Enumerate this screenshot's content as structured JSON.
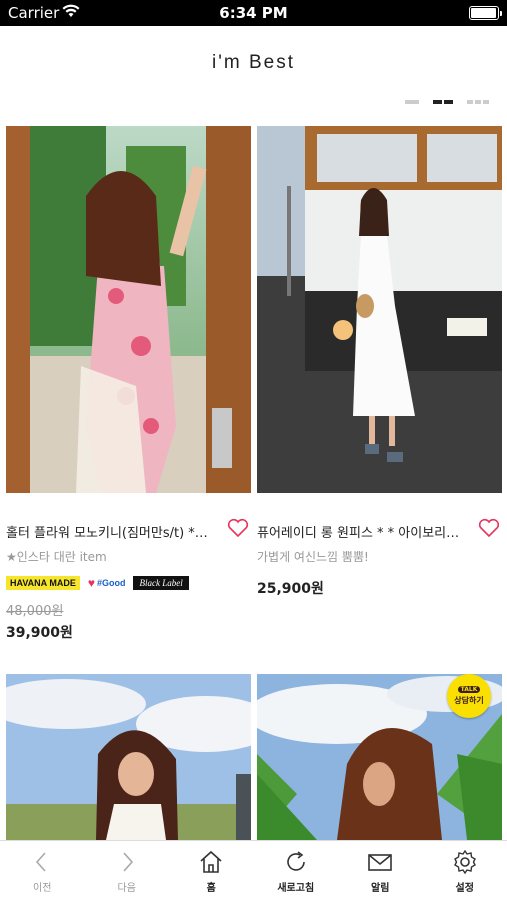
{
  "status_bar": {
    "carrier": "Carrier",
    "time": "6:34 PM"
  },
  "page": {
    "title": "i'm Best"
  },
  "products": [
    {
      "name": "홀터 플라워 모노키니(짐머만s/t) *…",
      "desc": "★인스타 대란 item",
      "badges": {
        "yellow": "HAVANA MADE",
        "good": "#Good",
        "black": "Black Label"
      },
      "old_price": "48,000원",
      "price": "39,900원"
    },
    {
      "name": "퓨어레이디 롱 원피스 * * 아이보리…",
      "desc": "가볍게 여신느낌 뿜뿜!",
      "price": "25,900원"
    },
    {
      "name": ""
    },
    {
      "name": ""
    }
  ],
  "talk_button": {
    "badge": "TALK",
    "label": "상담하기"
  },
  "bottom_nav": {
    "prev": "이전",
    "next": "다음",
    "home": "홈",
    "refresh": "새로고침",
    "notifications": "알림",
    "settings": "설정"
  },
  "colors": {
    "heart": "#e8335a",
    "accent_yellow": "#f5e52c",
    "kakao_yellow": "#f9e000"
  }
}
